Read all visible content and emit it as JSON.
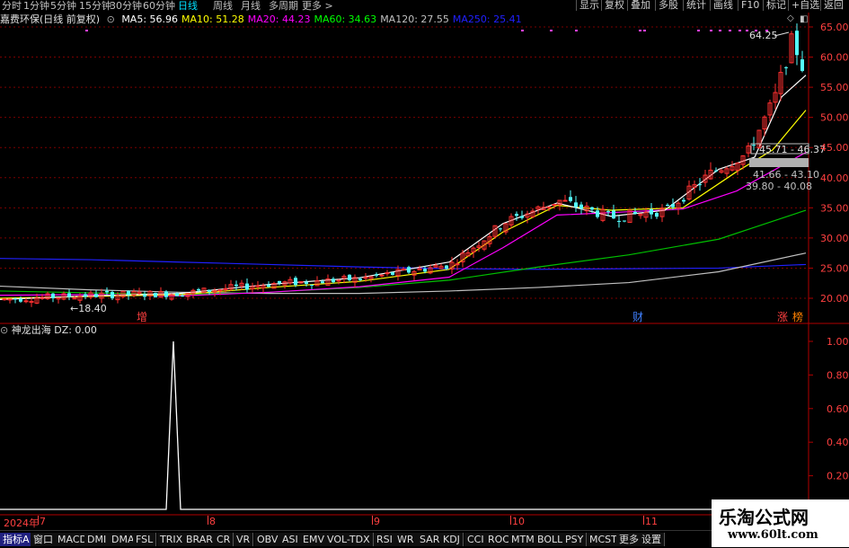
{
  "topbar": {
    "periods": [
      "分时",
      "1分钟",
      "5分钟",
      "15分钟",
      "30分钟",
      "60分钟",
      "日线",
      "周线",
      "月线",
      "多周期",
      "更多 >"
    ],
    "active": "日线",
    "right_buttons": [
      "显示",
      "复权",
      "叠加",
      "多股",
      "统计",
      "画线",
      "F10",
      "标记",
      "+自选",
      "返回"
    ]
  },
  "stock": {
    "name": "嘉费环保(日线 前复权)",
    "ma_labels": [
      {
        "text": "MA5: 56.96",
        "color": "#ffffff"
      },
      {
        "text": "MA10: 51.28",
        "color": "#ffff00"
      },
      {
        "text": "MA20: 44.23",
        "color": "#ff00ff"
      },
      {
        "text": "MA60: 34.63",
        "color": "#00ff00"
      },
      {
        "text": "MA120: 27.55",
        "color": "#c0c0c0"
      },
      {
        "text": "MA250: 25.41",
        "color": "#2020ff"
      }
    ]
  },
  "price_axis": [
    "65.00",
    "60.00",
    "55.00",
    "50.00",
    "45.00",
    "40.00",
    "35.00",
    "30.00",
    "25.00",
    "20.00"
  ],
  "annotations": {
    "high": "64.25",
    "low": "←18.40",
    "box1": "45.71 - 46.37",
    "box2": "41.66 - 43.10",
    "box3": "39.80 - 40.08",
    "marker_zeng": "增",
    "marker_cai": "财",
    "marker_zhang": "涨",
    "marker_bang": "榜"
  },
  "indicator": {
    "title": "神龙出海",
    "value_label": "DZ: 0.00",
    "axis": [
      "1.00",
      "0.80",
      "0.60",
      "0.40",
      "0.20"
    ]
  },
  "xaxis": {
    "labels": [
      "2024年",
      "7",
      "8",
      "9",
      "10",
      "11"
    ]
  },
  "bottombar": {
    "items": [
      "指标A",
      "窗口",
      "MACD",
      "DMI",
      "DMA",
      "FSL",
      "TRIX",
      "BRAR",
      "CR",
      "VR",
      "OBV",
      "ASI",
      "EMV",
      "VOL-TDX",
      "RSI",
      "WR",
      "SAR",
      "KDJ",
      "CCI",
      "ROC",
      "MTM",
      "BOLL",
      "PSY",
      "MCST",
      "更多",
      "设置"
    ],
    "selected": "指标A"
  },
  "watermark": {
    "line1": "乐淘公式网",
    "line2": "www.60lt.com"
  }
}
